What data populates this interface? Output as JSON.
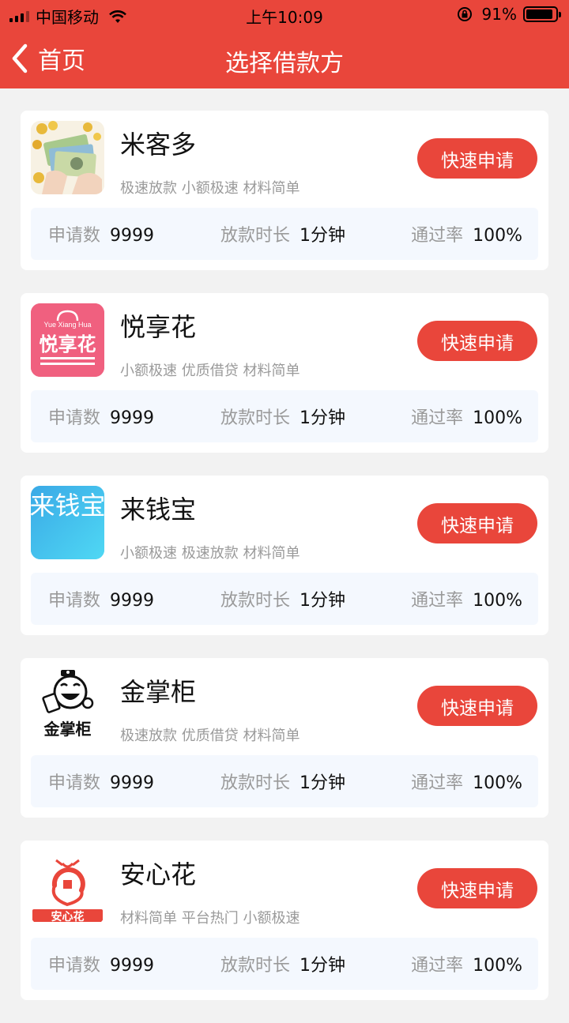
{
  "status_bar": {
    "carrier": "中国移动",
    "time": "上午10:09",
    "battery": "91%",
    "battery_level": 0.91
  },
  "nav": {
    "back_label": "首页",
    "title": "选择借款方"
  },
  "stat_labels": {
    "applications": "申请数",
    "loan_time": "放款时长",
    "pass_rate": "通过率"
  },
  "lenders": [
    {
      "name": "米客多",
      "tags": "极速放款 小额极速 材料简单",
      "button": "快速申请",
      "applications": "9999",
      "loan_time": "1分钟",
      "pass_rate": "100%",
      "logo_text": ""
    },
    {
      "name": "悦享花",
      "tags": "小额极速 优质借贷 材料简单",
      "button": "快速申请",
      "applications": "9999",
      "loan_time": "1分钟",
      "pass_rate": "100%",
      "logo_text": "Yue Xiang Hua 悦享花"
    },
    {
      "name": "来钱宝",
      "tags": "小额极速 极速放款 材料简单",
      "button": "快速申请",
      "applications": "9999",
      "loan_time": "1分钟",
      "pass_rate": "100%",
      "logo_text": "来钱宝"
    },
    {
      "name": "金掌柜",
      "tags": "极速放款 优质借贷 材料简单",
      "button": "快速申请",
      "applications": "9999",
      "loan_time": "1分钟",
      "pass_rate": "100%",
      "logo_text": "金掌柜"
    },
    {
      "name": "安心花",
      "tags": "材料简单 平台热门 小额极速",
      "button": "快速申请",
      "applications": "9999",
      "loan_time": "1分钟",
      "pass_rate": "100%",
      "logo_text": "安心花"
    }
  ],
  "colors": {
    "accent": "#e9463b",
    "stats_bg": "#f4f8fe"
  }
}
